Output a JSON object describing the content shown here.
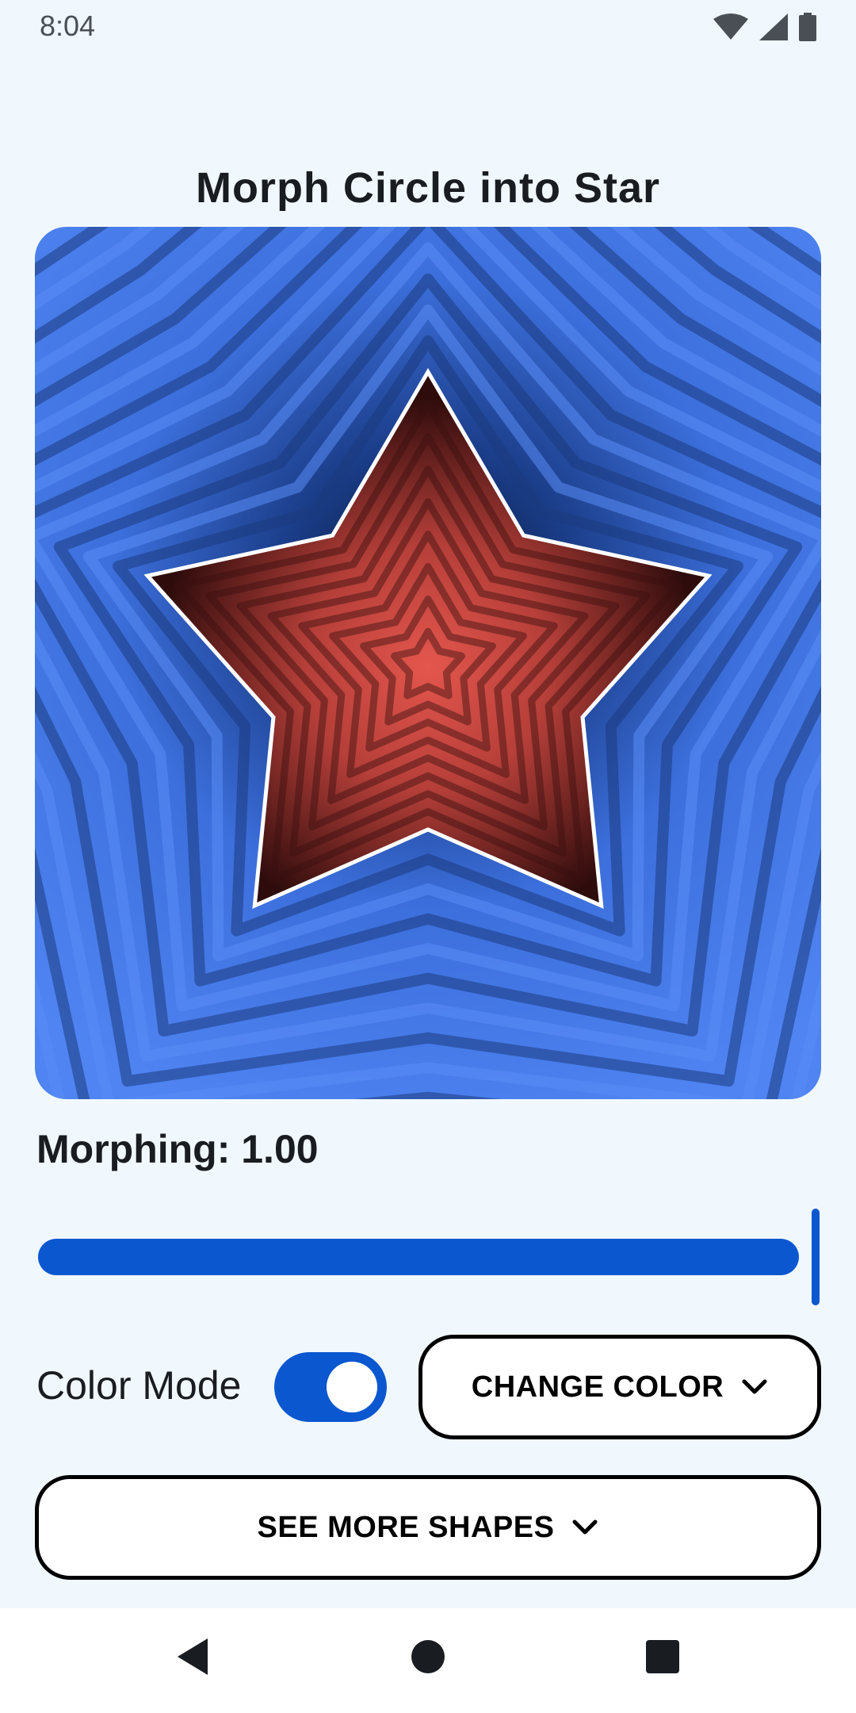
{
  "status_bar": {
    "time": "8:04",
    "icons": [
      "wifi-icon",
      "cell-signal-icon",
      "battery-icon"
    ]
  },
  "page": {
    "title": "Morph Circle into Star"
  },
  "canvas": {
    "shape": "star",
    "morph_progress": 1.0,
    "colors": {
      "background_light": "#4f82ef",
      "background_dark": "#0f2350",
      "shape_light": "#e4564d",
      "shape_dark": "#3a1010",
      "outline": "#ffffff"
    }
  },
  "morphing": {
    "label": "Morphing: 1.00",
    "value": 1.0,
    "min": 0.0,
    "max": 1.0
  },
  "color_mode": {
    "label": "Color Mode",
    "enabled": true
  },
  "buttons": {
    "change_color": "CHANGE COLOR",
    "see_more_shapes": "SEE MORE SHAPES"
  },
  "nav": {
    "items": [
      "back-icon",
      "home-icon",
      "recents-icon"
    ]
  },
  "theme": {
    "accent": "#0b57d0",
    "surface": "#f1f8fd"
  }
}
